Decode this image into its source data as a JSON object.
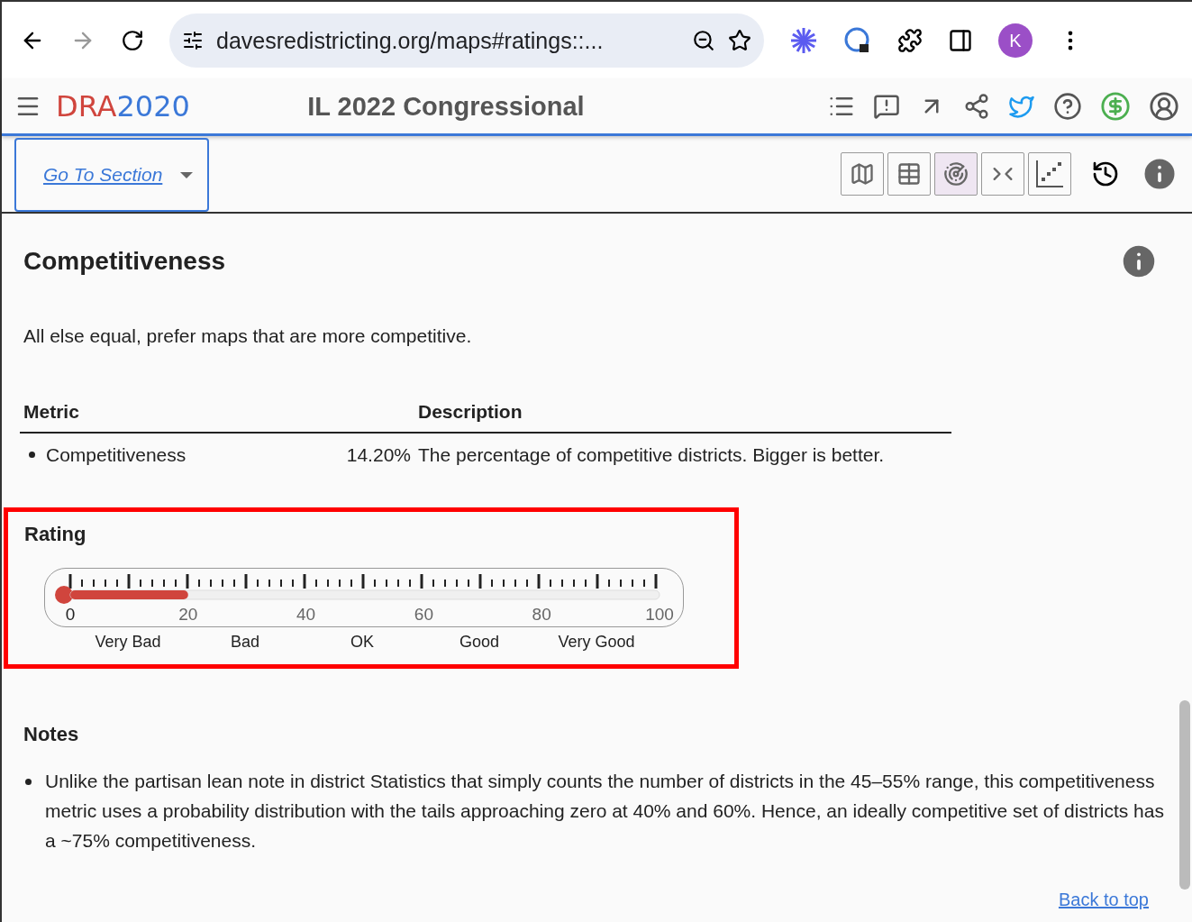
{
  "browser": {
    "url": "davesredistricting.org/maps#ratings::...",
    "avatar": "K"
  },
  "app": {
    "logo_red": "DRA",
    "logo_blue": "2020",
    "title": "IL 2022 Congressional"
  },
  "section_bar": {
    "goto": "Go To Section",
    "views": [
      {
        "kind": "map",
        "selected": false
      },
      {
        "kind": "table",
        "selected": false
      },
      {
        "kind": "gauge",
        "selected": true
      },
      {
        "kind": "compare",
        "selected": false
      },
      {
        "kind": "scatter",
        "selected": false
      }
    ]
  },
  "section": {
    "title": "Competitiveness",
    "intro": "All else equal, prefer maps that are more competitive.",
    "table": {
      "columns": [
        "Metric",
        "Description"
      ],
      "rows": [
        {
          "metric": "Competitiveness",
          "value": "14.20%",
          "description": "The percentage of competitive districts. Bigger is better."
        }
      ]
    },
    "rating": {
      "title": "Rating",
      "level": 0.2,
      "scale": [
        "0",
        "20",
        "40",
        "60",
        "80",
        "100"
      ],
      "bands": [
        "Very Bad",
        "Bad",
        "OK",
        "Good",
        "Very Good"
      ]
    },
    "notes": {
      "title": "Notes",
      "items": [
        "Unlike the partisan lean note in district Statistics that simply counts the number of districts in the 45–55% range, this competitiveness metric uses a probability distribution with the tails approaching zero at 40% and 60%. Hence, an ideally competitive set of districts has a ~75% competitiveness."
      ]
    },
    "back_link": "Back to top"
  }
}
